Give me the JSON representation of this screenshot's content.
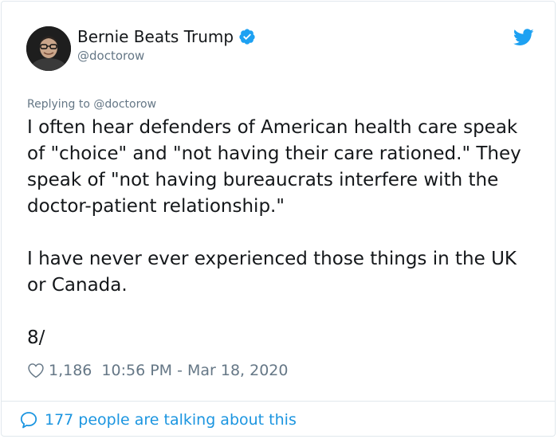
{
  "user": {
    "display_name": "Bernie Beats Trump",
    "handle": "@doctorow",
    "verified": true,
    "avatar_icon": "user-avatar-photo"
  },
  "brand": {
    "icon": "twitter-bird-icon",
    "color": "#1da1f2"
  },
  "tweet": {
    "reply_prefix": "Replying to",
    "reply_mention": "@doctorow",
    "paragraphs": [
      "I often hear defenders of American health care speak of \"choice\" and \"not having their care rationed.\" They speak of \"not having bureaucrats interfere with the doctor-patient relationship.\"",
      "I have never ever experienced those things in the UK or Canada.",
      "8/"
    ],
    "likes": "1,186",
    "timestamp": "10:56 PM - Mar 18, 2020"
  },
  "footer": {
    "talking_label": "177 people are talking about this",
    "icon": "comment-bubble-icon"
  },
  "colors": {
    "text": "#14171a",
    "secondary": "#657786",
    "link": "#1b95e0",
    "verified": "#1da1f2",
    "border": "#e1e8ed"
  }
}
